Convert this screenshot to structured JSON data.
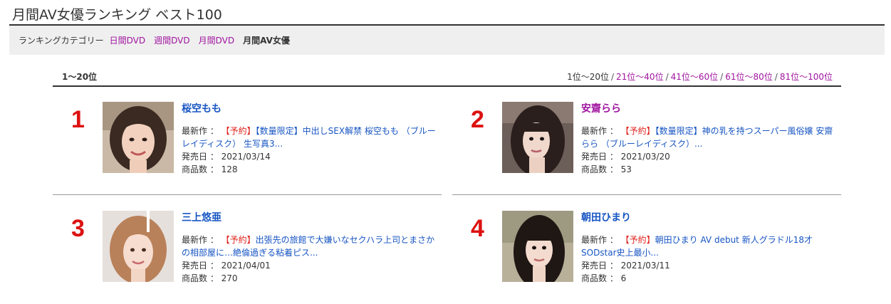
{
  "page": {
    "title": "月間AV女優ランキング ベスト100"
  },
  "categories": {
    "label": "ランキングカテゴリー",
    "links": [
      "日間DVD",
      "週間DVD",
      "月間DVD"
    ],
    "current": "月間AV女優"
  },
  "pager": {
    "current_range": "1〜20位",
    "current_page": "1位〜20位",
    "separator": "/",
    "pages": [
      "21位〜40位",
      "41位〜60位",
      "61位〜80位",
      "81位〜100位"
    ]
  },
  "ranking": [
    {
      "rank": "1",
      "name": "桜空もも",
      "latest_label": "最新作 ：",
      "latest_tag": "【予約】",
      "latest_title": "【数量限定】中出しSEX解禁 桜空もも （ブルーレイディスク） 生写真3...",
      "release_label": "発売日 ：",
      "release_date": "2021/03/14",
      "count_label": "商品数 ：",
      "count": "128"
    },
    {
      "rank": "2",
      "name": "安齋らら",
      "latest_label": "最新作 ：",
      "latest_tag": "【予約】",
      "latest_title": "【数量限定】神の乳を持つスーパー風俗嬢 安齋らら （ブルーレイディスク）...",
      "release_label": "発売日 ：",
      "release_date": "2021/03/20",
      "count_label": "商品数 ：",
      "count": "53"
    },
    {
      "rank": "3",
      "name": "三上悠亜",
      "latest_label": "最新作 ：",
      "latest_tag": "【予約】",
      "latest_title": "出張先の旅館で大嫌いなセクハラ上司とまさかの相部屋に…絶倫過ぎる粘着ピス...",
      "release_label": "発売日 ：",
      "release_date": "2021/04/01",
      "count_label": "商品数 ：",
      "count": "270"
    },
    {
      "rank": "4",
      "name": "朝田ひまり",
      "latest_label": "最新作 ：",
      "latest_tag": "【予約】",
      "latest_title": "朝田ひまり AV debut 新人グラドル18才 SODstar史上最小...",
      "release_label": "発売日 ：",
      "release_date": "2021/03/11",
      "count_label": "商品数 ：",
      "count": "6"
    }
  ],
  "colors": {
    "link": "#1755c3",
    "visited": "#a0149f",
    "rank": "#dd1111",
    "tag": "#e0251f"
  }
}
